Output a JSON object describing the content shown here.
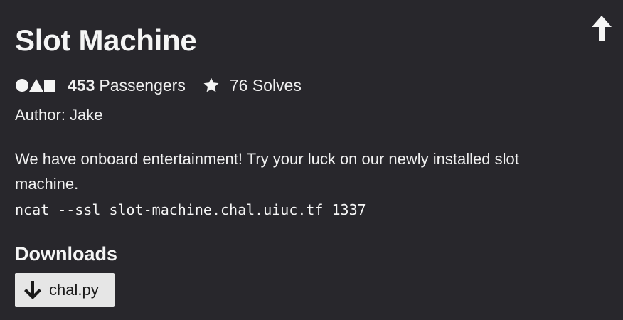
{
  "challenge": {
    "title": "Slot Machine",
    "passengers_count": "453",
    "passengers_label": "Passengers",
    "solves_text": "76 Solves",
    "author": "Author: Jake",
    "description": "We have onboard entertainment! Try your luck on our newly installed slot machine.",
    "command": "ncat --ssl slot-machine.chal.uiuc.tf 1337"
  },
  "downloads": {
    "heading": "Downloads",
    "files": [
      {
        "name": "chal.py"
      }
    ]
  },
  "icons": {
    "top": "arrow-up-icon",
    "passengers": "shapes-icon",
    "solves": "star-icon",
    "download": "arrow-down-icon"
  },
  "colors": {
    "background": "#28272c",
    "text": "#f2f2f2",
    "button_bg": "#e6e6e6",
    "button_text": "#1b1b1b"
  }
}
